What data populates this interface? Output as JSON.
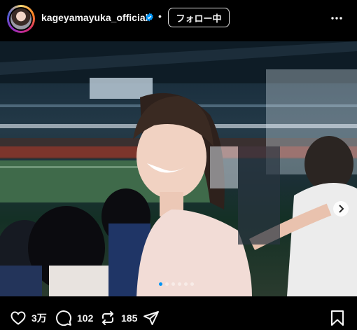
{
  "post": {
    "username": "kageyamayuka_official",
    "follow_label": "フォロー中",
    "separator": "•"
  },
  "carousel": {
    "slide_count": 6,
    "active_index": 0
  },
  "actions": {
    "like_count": "3万",
    "comment_count": "102",
    "repost_count": "185"
  },
  "colors": {
    "accent_blue": "#0095f6",
    "verified_blue": "#0095f6",
    "background": "#000000"
  },
  "icons": [
    "verified-badge-icon",
    "more-options-icon",
    "next-chevron-icon",
    "heart-icon",
    "comment-icon",
    "repost-icon",
    "share-icon",
    "bookmark-icon"
  ]
}
